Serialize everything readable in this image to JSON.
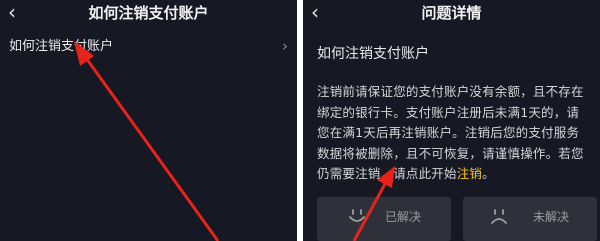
{
  "left": {
    "title": "如何注销支付账户",
    "row_label": "如何注销支付账户",
    "row_chevron": "›"
  },
  "right": {
    "title": "问题详情",
    "detail_title": "如何注销支付账户",
    "body_text": "注销前请保证您的支付账户没有余额，且不存在绑定的银行卡。支付账户注册后未满1天的，请您在满1天后再注销账户。注销后您的支付服务数据将被删除，且不可恢复，请谨慎操作。若您仍需要注销，请点此开始",
    "link_text": "注销",
    "body_end": "。",
    "feedback": {
      "solved_label": "已解决",
      "unsolved_label": "未解决"
    }
  },
  "back_glyph": "‹",
  "colors": {
    "panel_bg": "#161823",
    "link": "#f5c518",
    "annotation_arrow": "#e8231a",
    "button_bg": "#2f313a"
  },
  "icons": [
    "back-icon",
    "chevron-right-icon",
    "smile-face-icon",
    "sad-face-icon",
    "red-arrow-annotation"
  ]
}
